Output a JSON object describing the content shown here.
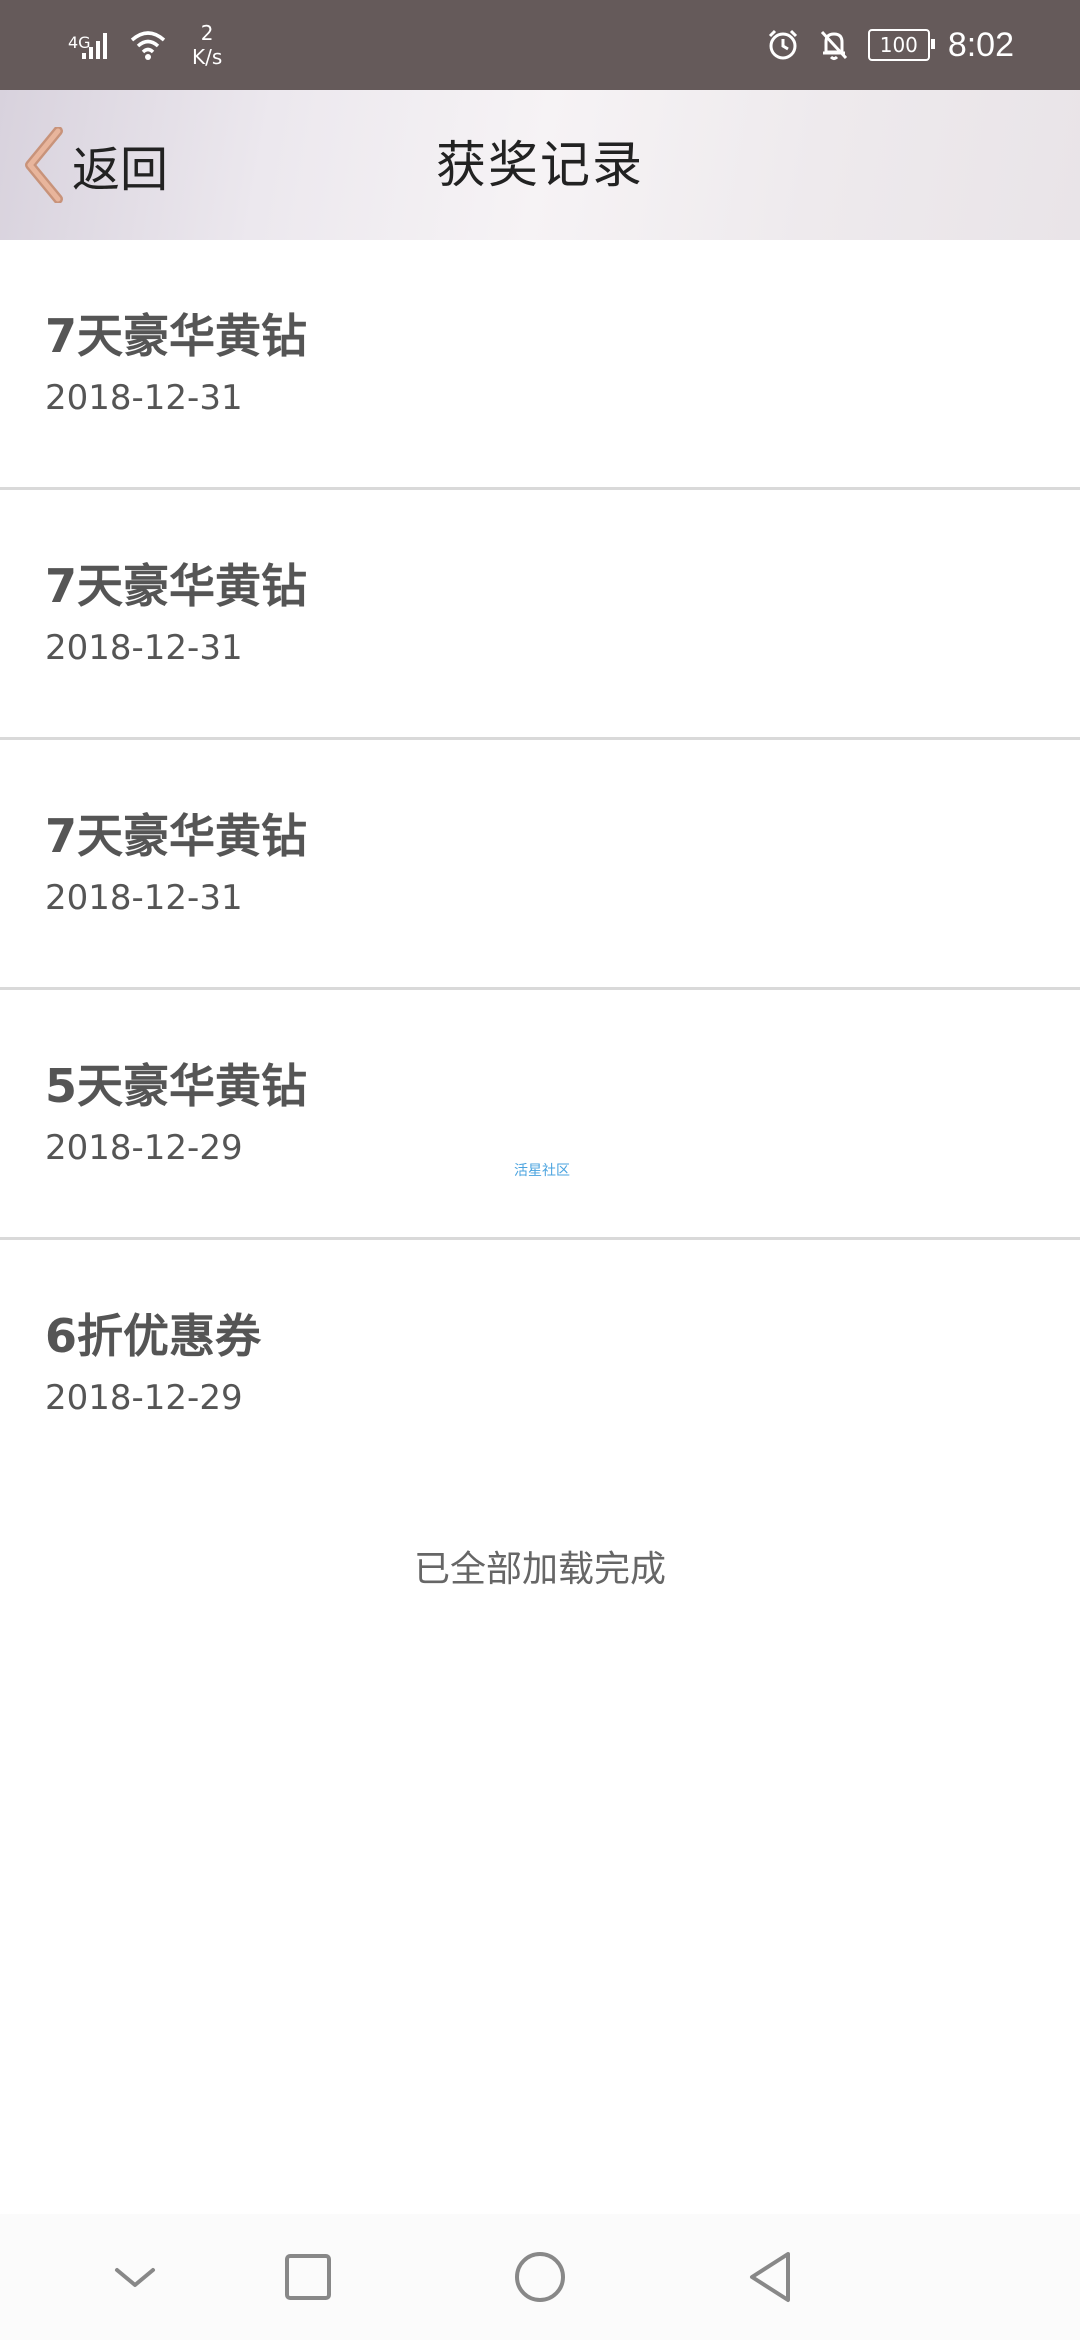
{
  "status_bar": {
    "network": "4G",
    "speed_value": "2",
    "speed_unit": "K/s",
    "battery": "100",
    "time": "8:02"
  },
  "header": {
    "back_label": "返回",
    "title": "获奖记录"
  },
  "records": [
    {
      "title": "7天豪华黄钻",
      "date": "2018-12-31"
    },
    {
      "title": "7天豪华黄钻",
      "date": "2018-12-31"
    },
    {
      "title": "7天豪华黄钻",
      "date": "2018-12-31"
    },
    {
      "title": "5天豪华黄钻",
      "date": "2018-12-29"
    },
    {
      "title": "6折优惠券",
      "date": "2018-12-29"
    }
  ],
  "watermark": "活星社区",
  "end_message": "已全部加载完成",
  "nav_bar": {
    "buttons": [
      "collapse-icon",
      "recent-apps-icon",
      "home-icon",
      "back-icon"
    ]
  }
}
